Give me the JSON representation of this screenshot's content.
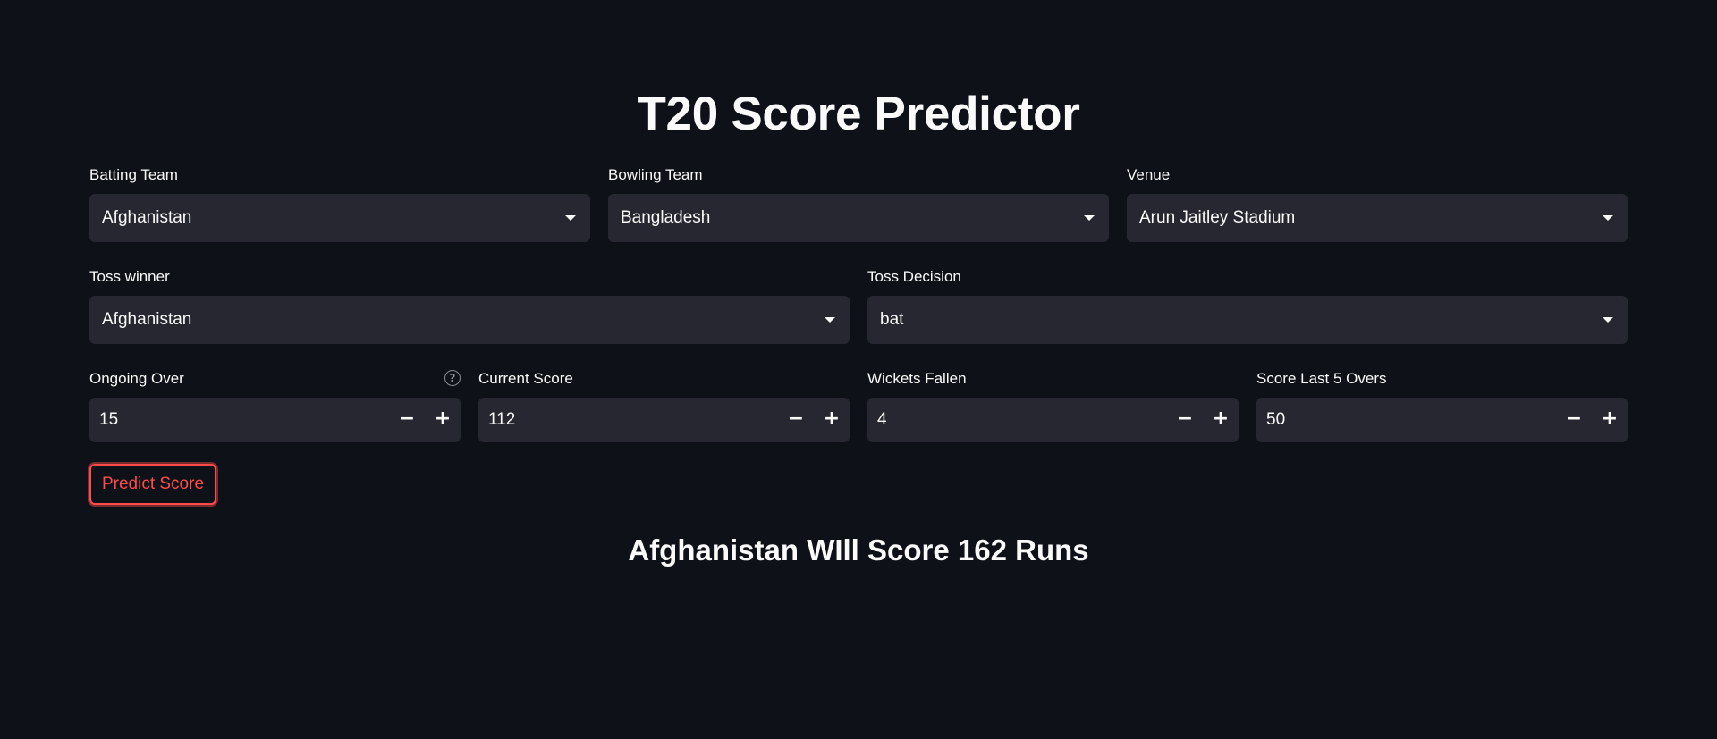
{
  "title": "T20 Score Predictor",
  "colors": {
    "background": "#0e1117",
    "input_background": "#262730",
    "accent": "#ff4b4b",
    "text": "#fafafa"
  },
  "batting_team": {
    "label": "Batting Team",
    "value": "Afghanistan"
  },
  "bowling_team": {
    "label": "Bowling Team",
    "value": "Bangladesh"
  },
  "venue": {
    "label": "Venue",
    "value": "Arun Jaitley Stadium"
  },
  "toss_winner": {
    "label": "Toss winner",
    "value": "Afghanistan"
  },
  "toss_decision": {
    "label": "Toss Decision",
    "value": "bat"
  },
  "ongoing_over": {
    "label": "Ongoing Over",
    "value": "15",
    "help_icon": "question-circle-icon"
  },
  "current_score": {
    "label": "Current Score",
    "value": "112"
  },
  "wickets_fallen": {
    "label": "Wickets Fallen",
    "value": "4"
  },
  "score_last_5": {
    "label": "Score Last 5 Overs",
    "value": "50"
  },
  "stepper": {
    "minus": "−",
    "plus": "+"
  },
  "predict_button": {
    "label": "Predict Score"
  },
  "result": {
    "text": "Afghanistan WIll Score 162 Runs"
  }
}
